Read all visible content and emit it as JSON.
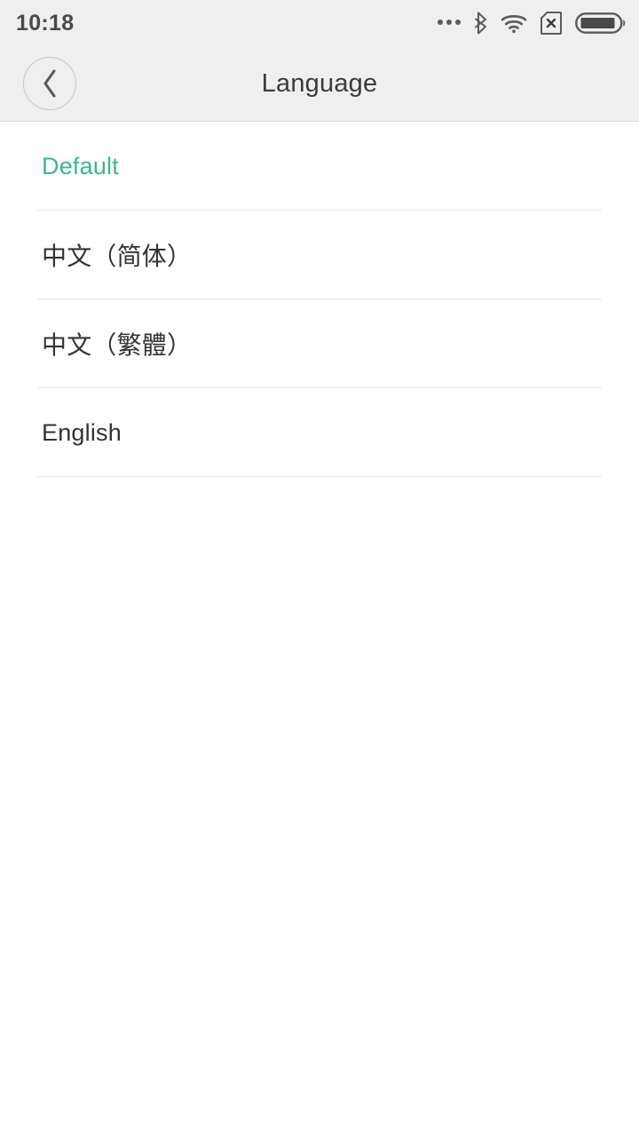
{
  "statusbar": {
    "time": "10:18",
    "icons": [
      {
        "name": "more-dots-icon",
        "label": "..."
      },
      {
        "name": "bluetooth-icon",
        "label": "bluetooth"
      },
      {
        "name": "wifi-icon",
        "label": "wifi"
      },
      {
        "name": "no-sim-card-icon",
        "label": "no-sim"
      },
      {
        "name": "battery-icon",
        "label": "battery",
        "level_percent": 82
      }
    ],
    "background_color": "#efefef",
    "text_color": "#4a4a4a"
  },
  "appbar": {
    "title": "Language",
    "back_icon": "chevron-left-icon",
    "background_color": "#efefef",
    "border_color": "#dcdcdc",
    "title_color": "#3c3c3c"
  },
  "theme": {
    "accent_color": "#3db887",
    "item_text_color": "#333333",
    "divider_color": "#e6e6e6",
    "page_background": "#ffffff"
  },
  "language_list": {
    "selected_index": 0,
    "items": [
      {
        "label": "Default",
        "selected": true
      },
      {
        "label": "中文（简体）",
        "selected": false
      },
      {
        "label": "中文（繁體）",
        "selected": false
      },
      {
        "label": "English",
        "selected": false
      }
    ]
  }
}
